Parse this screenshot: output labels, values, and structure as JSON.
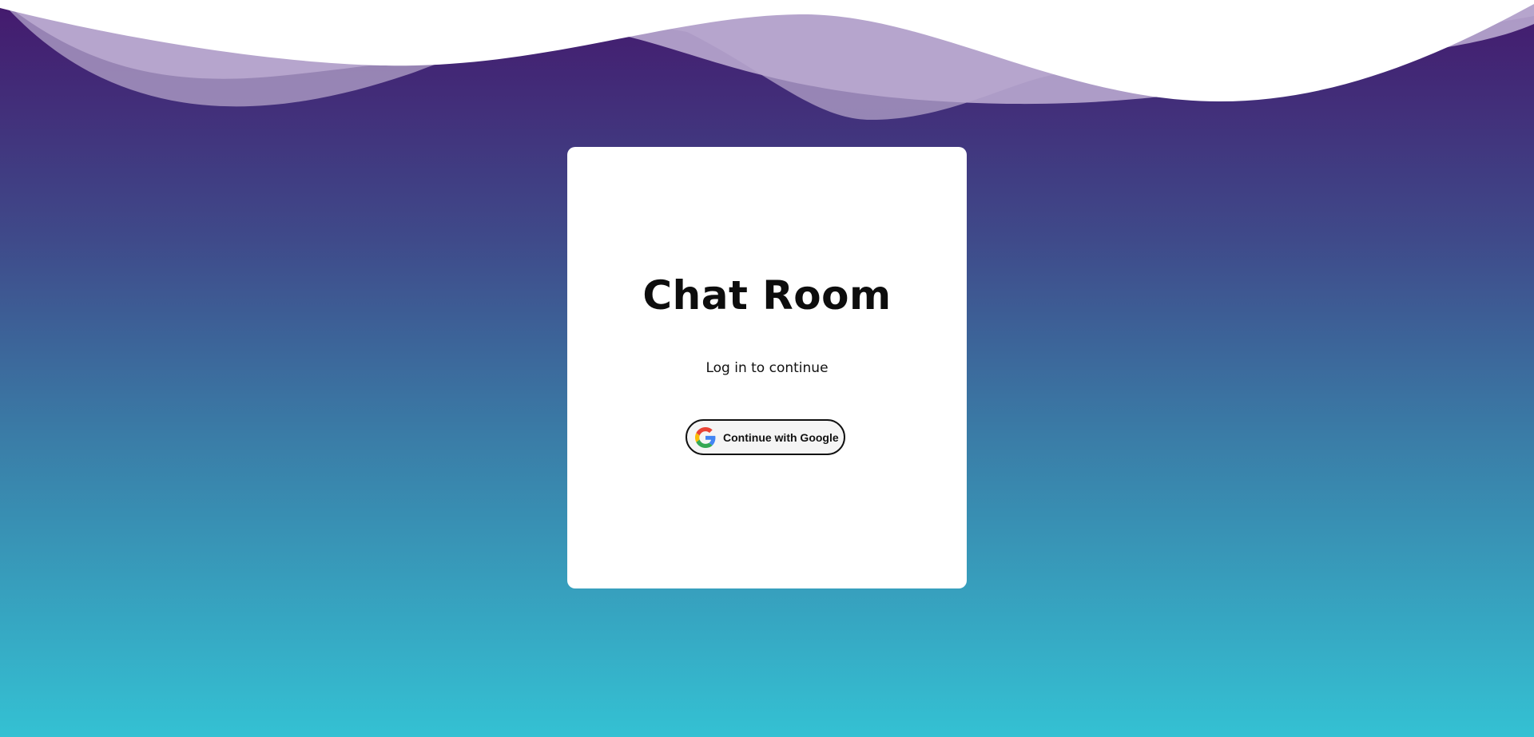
{
  "login_card": {
    "title": "Chat Room",
    "subtitle": "Log in to continue",
    "google_button_label": "Continue with Google",
    "google_icon": "google-g-icon"
  },
  "colors": {
    "gradient_top": "#44196d",
    "gradient_middle": "#3f4a8a",
    "gradient_bottom": "#34c1d3",
    "wave_fill": "#ffffff",
    "wave_tint": "#b7a6cb",
    "card_background": "#ffffff",
    "button_background": "#f5f5f5",
    "text": "#0d0d0d"
  }
}
